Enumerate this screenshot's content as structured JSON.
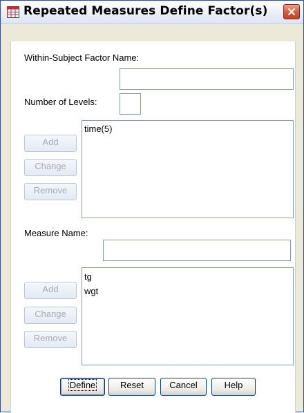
{
  "window": {
    "title": "Repeated Measures Define Factor(s)",
    "accent": "#2b4f9e",
    "close_color": "#d05a3c"
  },
  "factor": {
    "name_label": "Within-Subject Factor Name:",
    "name_value": "",
    "levels_label": "Number of Levels:",
    "levels_value": "",
    "list": [
      "time(5)"
    ],
    "add_label": "Add",
    "change_label": "Change",
    "remove_label": "Remove"
  },
  "measure": {
    "name_label": "Measure Name:",
    "name_value": "",
    "list": [
      "tg",
      "wgt"
    ],
    "add_label": "Add",
    "change_label": "Change",
    "remove_label": "Remove"
  },
  "buttons": {
    "define": "Define",
    "reset": "Reset",
    "cancel": "Cancel",
    "help": "Help"
  }
}
